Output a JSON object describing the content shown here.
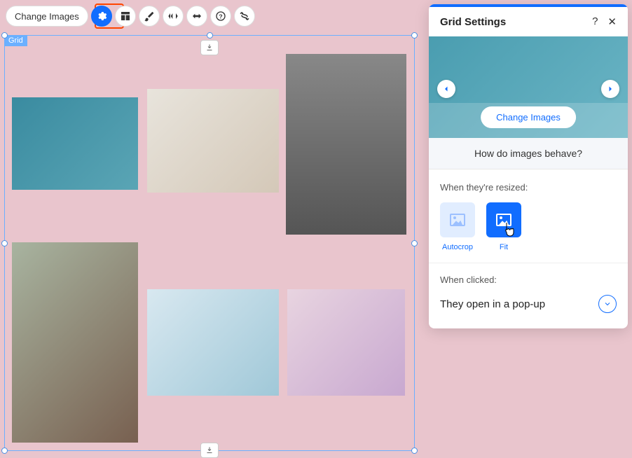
{
  "toolbar": {
    "change_images_label": "Change Images"
  },
  "canvas": {
    "label": "Grid"
  },
  "panel": {
    "title": "Grid Settings",
    "help": "?",
    "close": "✕",
    "hero_button": "Change Images",
    "subheading": "How do images behave?",
    "resize_label": "When they're resized:",
    "modes": {
      "autocrop": "Autocrop",
      "fit": "Fit"
    },
    "click_label": "When clicked:",
    "click_value": "They open in a pop-up"
  }
}
